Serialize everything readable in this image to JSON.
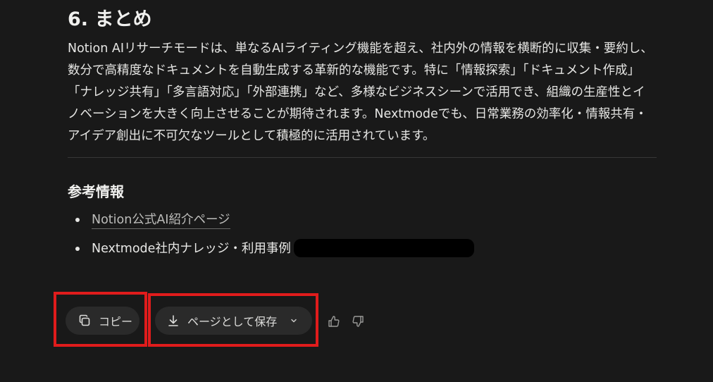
{
  "section": {
    "title": "6. まとめ",
    "paragraph": "Notion AIリサーチモードは、単なるAIライティング機能を超え、社内外の情報を横断的に収集・要約し、数分で高精度なドキュメントを自動生成する革新的な機能です。特に「情報探索」「ドキュメント作成」「ナレッジ共有」「多言語対応」「外部連携」など、多様なビジネスシーンで活用でき、組織の生産性とイノベーションを大きく向上させることが期待されます。Nextmodeでも、日常業務の効率化・情報共有・アイデア創出に不可欠なツールとして積極的に活用されています。"
  },
  "references": {
    "title": "参考情報",
    "items": [
      {
        "label": "Notion公式AI紹介ページ"
      },
      {
        "label": "Nextmode社内ナレッジ・利用事例"
      }
    ]
  },
  "actions": {
    "copy_label": "コピー",
    "save_label": "ページとして保存"
  },
  "colors": {
    "background": "#191919",
    "highlight": "#e01c1c",
    "pill": "#2a2a2a"
  },
  "icons": {
    "copy": "copy-icon",
    "save": "download-icon",
    "dropdown": "chevron-down-icon",
    "like": "thumbs-up-icon",
    "dislike": "thumbs-down-icon"
  }
}
